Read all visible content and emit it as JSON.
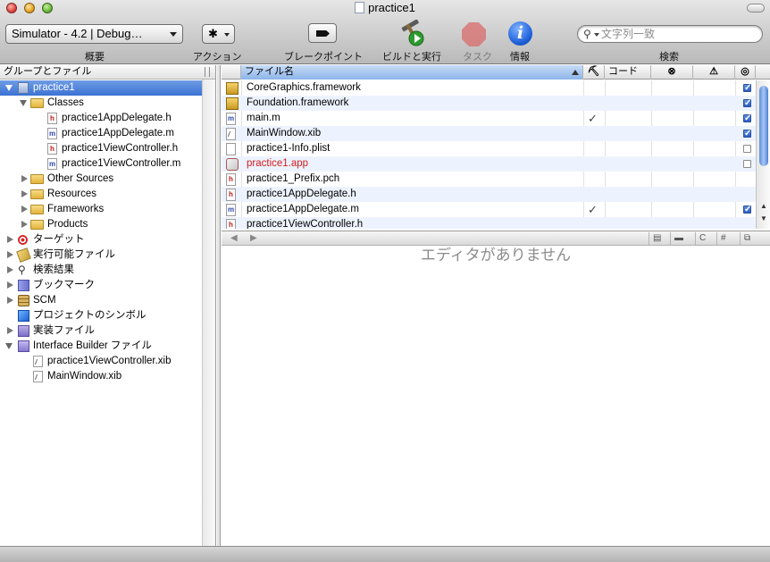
{
  "window": {
    "title": "practice1"
  },
  "toolbar": {
    "scheme_label": "Simulator - 4.2 | Debug…",
    "overview_label": "概要",
    "action_label": "アクション",
    "action_glyph": "✱",
    "breakpoints_label": "ブレークポイント",
    "build_run_label": "ビルドと実行",
    "tasks_label": "タスク",
    "info_label": "情報",
    "info_glyph": "i",
    "search_label": "検索",
    "search_placeholder": "文字列一致"
  },
  "sidebar": {
    "header": "グループとファイル",
    "items": [
      {
        "label": "practice1",
        "icon": "project-icon",
        "selected": true
      },
      {
        "label": "Classes",
        "icon": "folder-icon"
      },
      {
        "label": "practice1AppDelegate.h",
        "icon": "header-file-icon"
      },
      {
        "label": "practice1AppDelegate.m",
        "icon": "implementation-file-icon"
      },
      {
        "label": "practice1ViewController.h",
        "icon": "header-file-icon"
      },
      {
        "label": "practice1ViewController.m",
        "icon": "implementation-file-icon"
      },
      {
        "label": "Other Sources",
        "icon": "folder-icon"
      },
      {
        "label": "Resources",
        "icon": "folder-icon"
      },
      {
        "label": "Frameworks",
        "icon": "folder-icon"
      },
      {
        "label": "Products",
        "icon": "folder-icon"
      },
      {
        "label": "ターゲット",
        "icon": "target-icon"
      },
      {
        "label": "実行可能ファイル",
        "icon": "executable-icon"
      },
      {
        "label": "検索結果",
        "icon": "search-icon"
      },
      {
        "label": "ブックマーク",
        "icon": "bookmark-icon"
      },
      {
        "label": "SCM",
        "icon": "scm-icon"
      },
      {
        "label": "プロジェクトのシンボル",
        "icon": "symbol-icon"
      },
      {
        "label": "実装ファイル",
        "icon": "implementation-files-icon"
      },
      {
        "label": "Interface Builder ファイル",
        "icon": "interface-builder-icon"
      },
      {
        "label": "practice1ViewController.xib",
        "icon": "xib-file-icon"
      },
      {
        "label": "MainWindow.xib",
        "icon": "xib-file-icon"
      }
    ]
  },
  "file_table": {
    "columns": {
      "name": "ファイル名",
      "build": "⛏",
      "code": "コード",
      "errors": "⊗",
      "warnings": "⚠",
      "target": "◎"
    },
    "rows": [
      {
        "name": "CoreGraphics.framework",
        "icon": "framework-icon",
        "build_check": "",
        "target": true,
        "red": false
      },
      {
        "name": "Foundation.framework",
        "icon": "framework-icon",
        "build_check": "",
        "target": true,
        "red": false
      },
      {
        "name": "main.m",
        "icon": "implementation-file-icon",
        "build_check": "✓",
        "target": true,
        "red": false
      },
      {
        "name": "MainWindow.xib",
        "icon": "xib-file-icon",
        "build_check": "",
        "target": true,
        "red": false
      },
      {
        "name": "practice1-Info.plist",
        "icon": "plist-file-icon",
        "build_check": "",
        "target": false,
        "red": false
      },
      {
        "name": "practice1.app",
        "icon": "app-icon",
        "build_check": "",
        "target": false,
        "red": true
      },
      {
        "name": "practice1_Prefix.pch",
        "icon": "header-file-icon",
        "build_check": "",
        "target": null,
        "red": false
      },
      {
        "name": "practice1AppDelegate.h",
        "icon": "header-file-icon",
        "build_check": "",
        "target": null,
        "red": false
      },
      {
        "name": "practice1AppDelegate.m",
        "icon": "implementation-file-icon",
        "build_check": "✓",
        "target": true,
        "red": false
      },
      {
        "name": "practice1ViewController.h",
        "icon": "header-file-icon",
        "build_check": "",
        "target": null,
        "red": false
      }
    ]
  },
  "editor": {
    "empty_message": "エディタがありません",
    "tools": [
      "C",
      "#"
    ]
  },
  "colors": {
    "selection": "#3b72d4",
    "missing_file": "#d51b1b",
    "alt_row": "#edf3fe"
  }
}
